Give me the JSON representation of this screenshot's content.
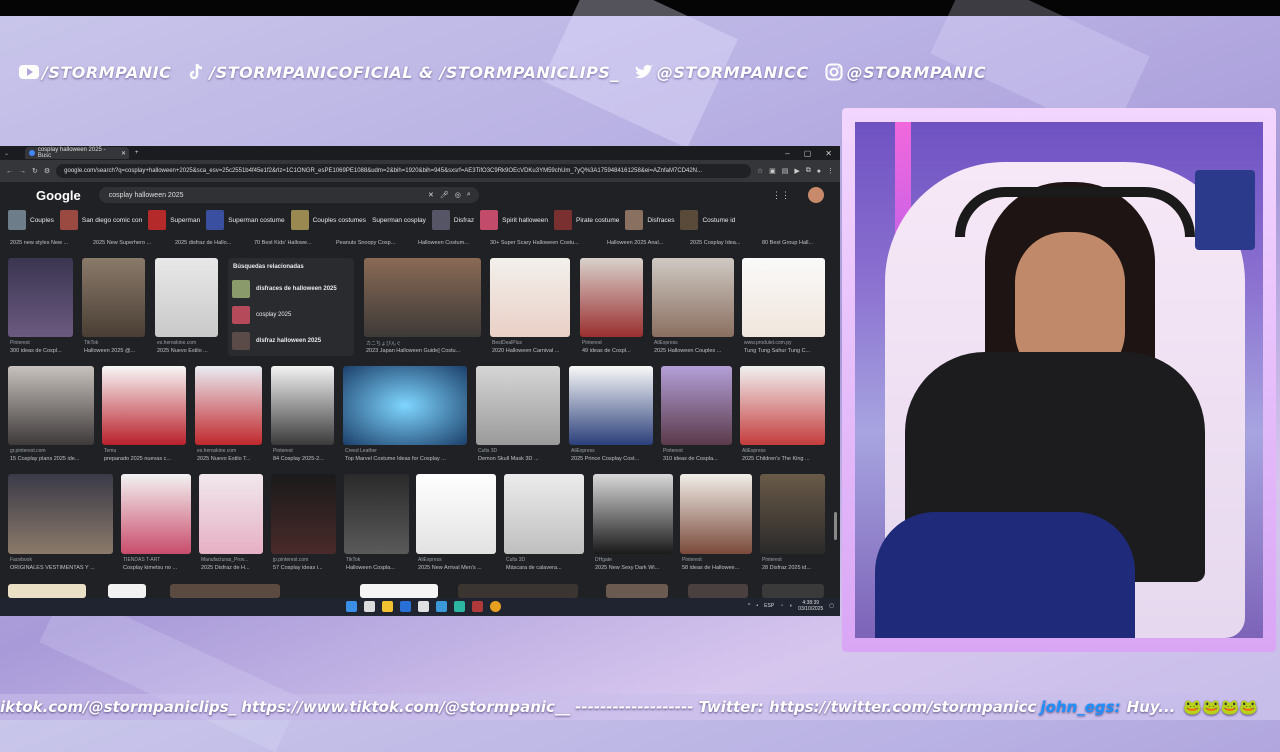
{
  "social": {
    "youtube": "/STORMPANIC",
    "tiktok": "/STORMPANICOFICIAL & /STORMPANICLIPS_",
    "twitter": "@STORMPANICC",
    "instagram": "@STORMPANIC"
  },
  "browser": {
    "tab_title": "cosplay halloween 2025 - Busc",
    "url": "google.com/search?q=cosplay+halloween+2025&sca_esv=25c2551b4f45e1f2&rlz=1C1ONGR_esPE1069PE1088&udm=2&bih=1920&bih=945&sxsrf=AE3TifO3C9Rk9OEcVDKu3YM59chUm_7yQ%3A1759484161258&ei=AZnfaM7CD42N...",
    "logo": "Google",
    "query": "cosplay halloween 2025",
    "chips": [
      "Couples",
      "San diego comic con",
      "Superman",
      "Superman costume",
      "Couples costumes",
      "Superman cosplay",
      "Disfraz",
      "Spirit halloween",
      "Pirate costume",
      "Disfraces",
      "Costume id"
    ],
    "top_captions": [
      "2025 new styles New ...",
      "2025 New Superhero ...",
      "2025 disfraz de Hallo...",
      "70 Best Kids' Hallowe...",
      "Peanuts Snoopy Cosp...",
      "Halloween Costum...",
      "30+ Super Scary Halloween Costu...",
      "Halloween 2025 Anal...",
      "2025 Cosplay Idea...",
      "80 Best Group Hall..."
    ],
    "related": {
      "heading": "Búsquedas relacionadas",
      "items": [
        "disfraces de halloween 2025",
        "cosplay 2025",
        "disfraz halloween 2025"
      ]
    },
    "row1": [
      {
        "src": "Pinterest",
        "cap": "300 ideas de Cospl..."
      },
      {
        "src": "TikTok",
        "cap": "Halloween 2025 @..."
      },
      {
        "src": "es.heroskine.com",
        "cap": "2025 Nuevo Estilo ..."
      },
      {
        "src": "カニちょびんぐ",
        "cap": "2023 Japan Halloween Guide] Costu..."
      },
      {
        "src": "BestDealPlus",
        "cap": "2020 Halloween Carnival ..."
      },
      {
        "src": "Pinterest",
        "cap": "49 ideas de Cospl..."
      },
      {
        "src": "AliExpress",
        "cap": "2025 Halloween Couples ..."
      },
      {
        "src": "www.produlet.com.py",
        "cap": "Tung Tung Sahur Tung C..."
      }
    ],
    "row2": [
      {
        "src": "gr.pinterest.com",
        "cap": "15 Cosplay plans 2025 ide..."
      },
      {
        "src": "Temu",
        "cap": "preparado 2025 nuevas c..."
      },
      {
        "src": "es.heroskine.com",
        "cap": "2025 Nuevo Estilo T..."
      },
      {
        "src": "Pinterest",
        "cap": "84 Cosplay 2025-2..."
      },
      {
        "src": "Creed Leather",
        "cap": "Top Marvel Costume Ideas for Cosplay ..."
      },
      {
        "src": "Cults 3D",
        "cap": "Demon Skull Mask 3D ..."
      },
      {
        "src": "AliExpress",
        "cap": "2025 Prince Cosplay Cost..."
      },
      {
        "src": "Pinterest",
        "cap": "310 ideas de Cospla..."
      },
      {
        "src": "AliExpress",
        "cap": "2025 Children's The King ..."
      }
    ],
    "row3": [
      {
        "src": "Facebook",
        "cap": "ORIGINALES VESTIMENTAS Y ..."
      },
      {
        "src": "TIENDAS T-ART",
        "cap": "Cosplay kimetsu no ..."
      },
      {
        "src": "Manufacturas_Prov...",
        "cap": "2025 Disfraz de H..."
      },
      {
        "src": "jp.pinterest.com",
        "cap": "57 Cosplay ideas i..."
      },
      {
        "src": "TikTok",
        "cap": "Halloween Cospla..."
      },
      {
        "src": "AliExpress",
        "cap": "2025 New Arrival Men's ..."
      },
      {
        "src": "Cults 3D",
        "cap": "Máscara de calavera..."
      },
      {
        "src": "DHgate",
        "cap": "2025 New Sexy Dark Wi..."
      },
      {
        "src": "Pinterest",
        "cap": "58 ideas de Hallowee..."
      },
      {
        "src": "Pinterest",
        "cap": "28 Disfraz 2025 id..."
      }
    ],
    "clock_time": "4:38:39",
    "clock_date": "03/10/2025",
    "lang": "ESP"
  },
  "ticker": {
    "text": "iktok.com/@stormpaniclips_  https://www.tiktok.com/@stormpanic__  -------------------  Twitter: https://twitter.com/stormpanicc",
    "user": "john_egs:",
    "message": "Huy..."
  }
}
